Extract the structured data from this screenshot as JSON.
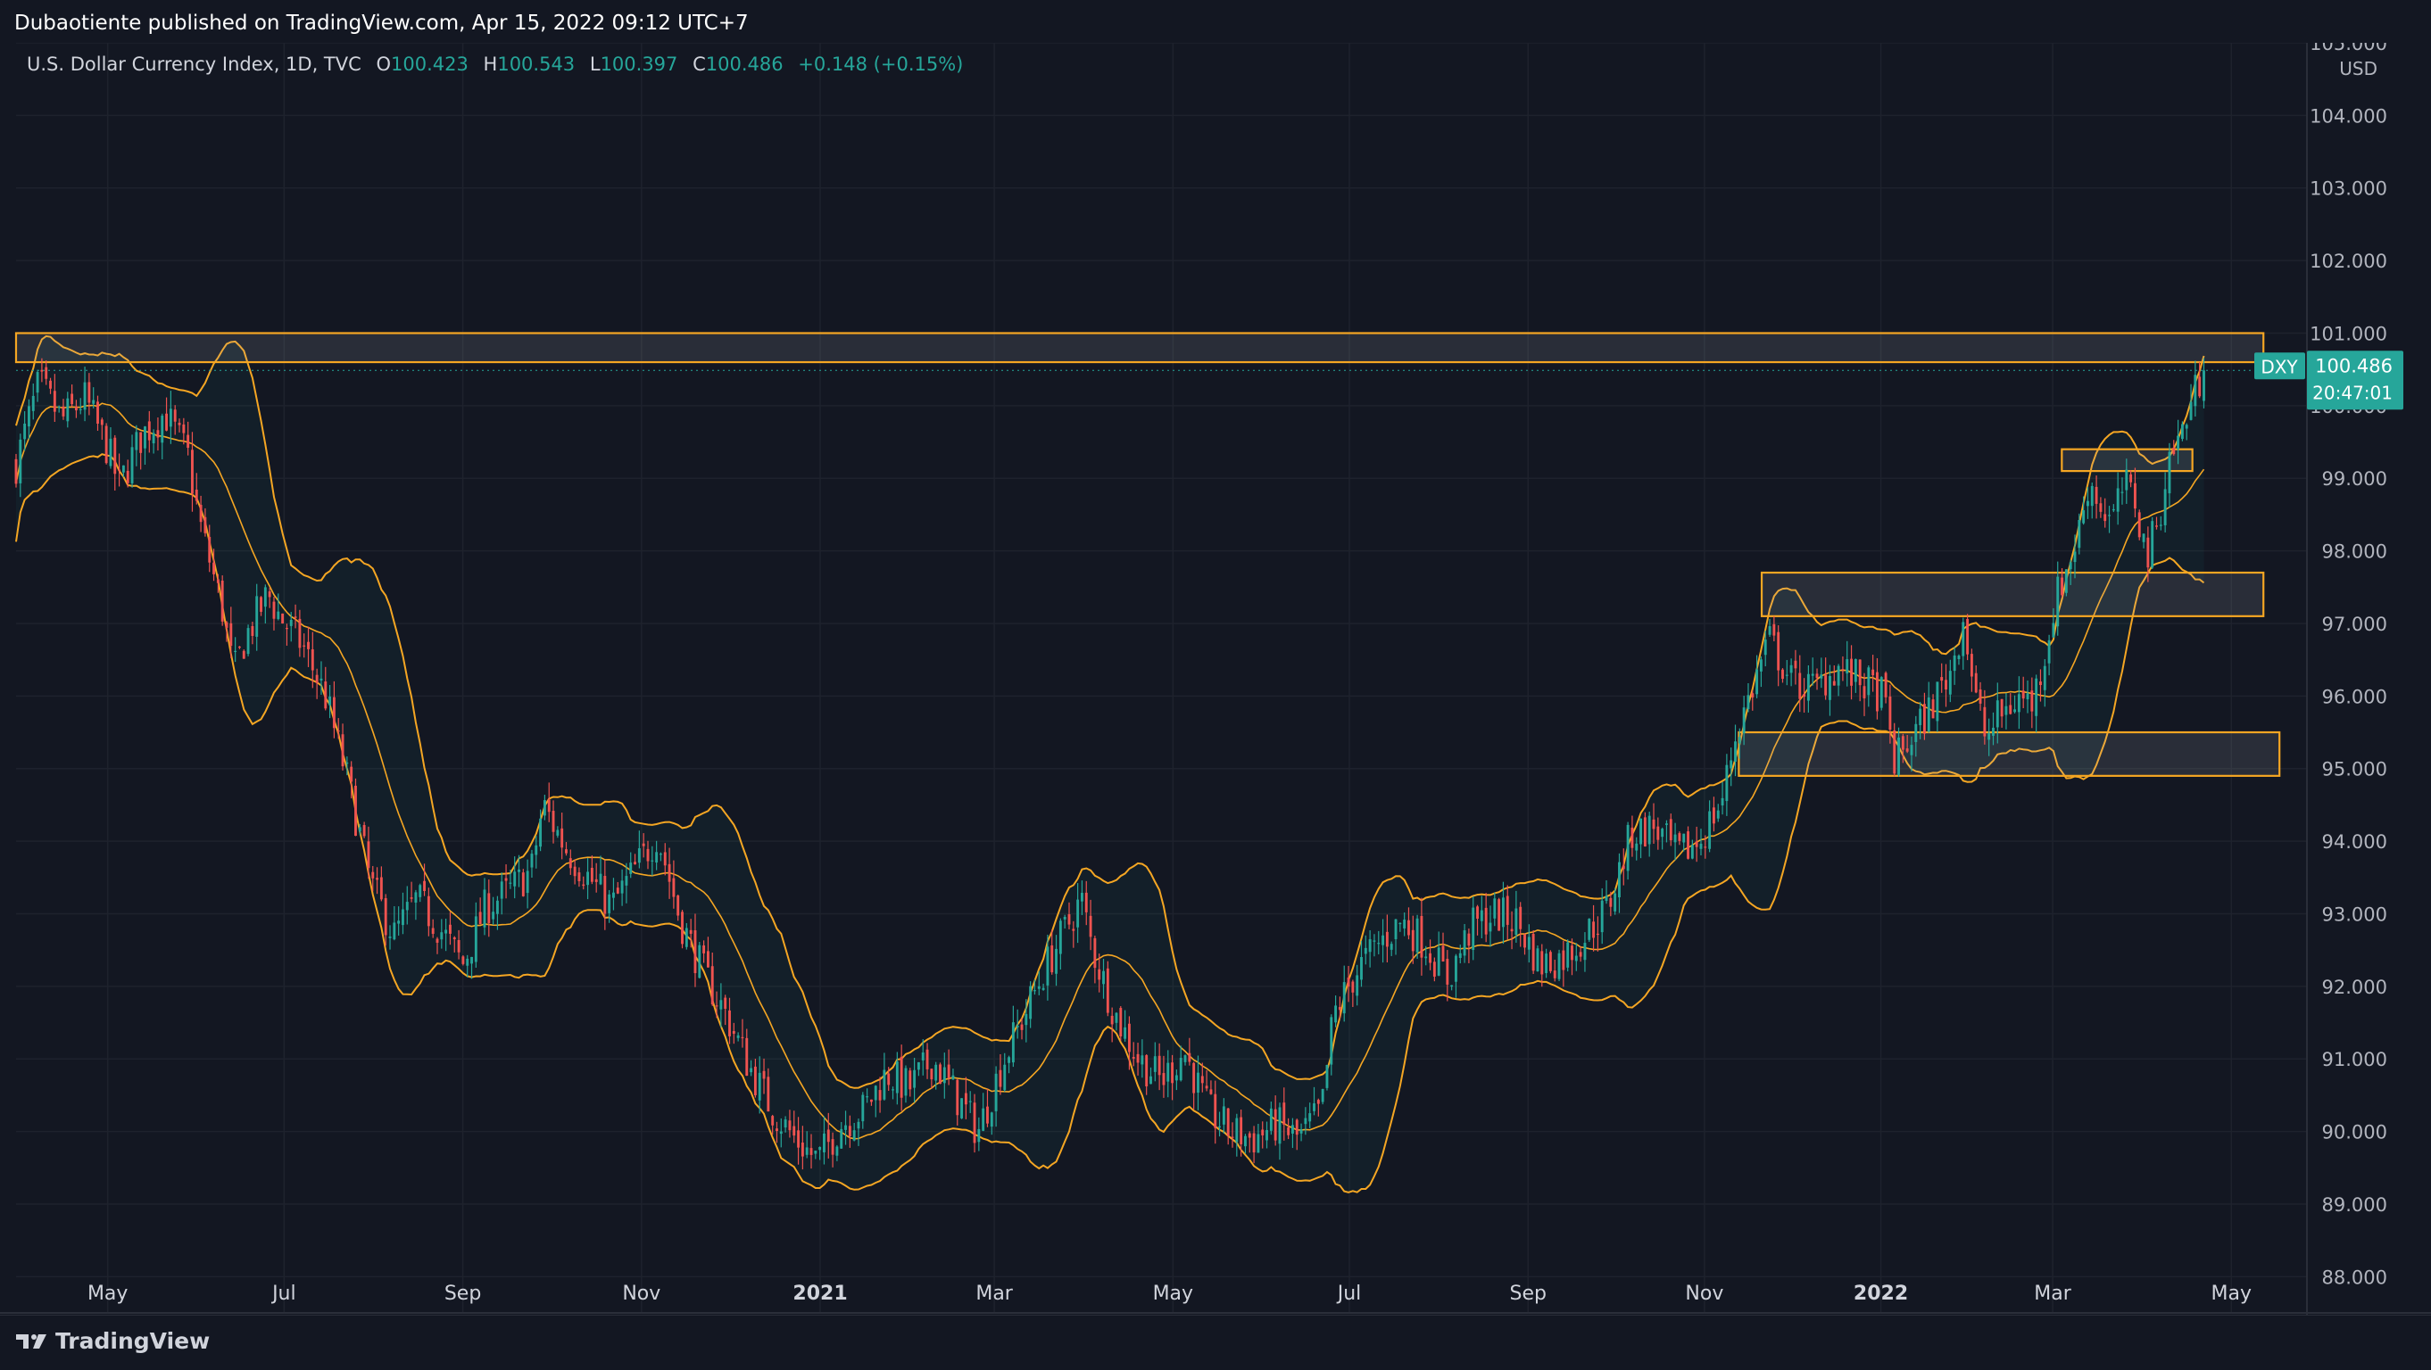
{
  "header": {
    "published": "Dubaotiente published on TradingView.com, Apr 15, 2022 09:12 UTC+7"
  },
  "legend": {
    "symbol": "U.S. Dollar Currency Index, 1D, TVC",
    "o_label": "O",
    "o": "100.423",
    "h_label": "H",
    "h": "100.543",
    "l_label": "L",
    "l": "100.397",
    "c_label": "C",
    "c": "100.486",
    "change": "+0.148 (+0.15%)"
  },
  "price_label": {
    "ticker": "DXY",
    "price": "100.486",
    "countdown": "20:47:01"
  },
  "footer": {
    "brand": "TradingView"
  },
  "colors": {
    "background": "#131722",
    "up": "#26a69a",
    "down": "#ef5350",
    "band": "#f5a623",
    "zone_border": "#f5a623"
  },
  "chart_data": {
    "type": "candlestick",
    "currency": "USD",
    "y_ticks": [
      "88.000",
      "89.000",
      "90.000",
      "91.000",
      "92.000",
      "93.000",
      "94.000",
      "95.000",
      "96.000",
      "97.000",
      "98.000",
      "99.000",
      "100.000",
      "101.000",
      "102.000",
      "103.000",
      "104.000",
      "105.000"
    ],
    "ylim": [
      87.5,
      105.0
    ],
    "x_ticks": [
      {
        "label": "May",
        "t": 0.04
      },
      {
        "label": "Jul",
        "t": 0.117
      },
      {
        "label": "Sep",
        "t": 0.195
      },
      {
        "label": "Nov",
        "t": 0.273
      },
      {
        "label": "2021",
        "t": 0.351,
        "bold": true
      },
      {
        "label": "Mar",
        "t": 0.427
      },
      {
        "label": "May",
        "t": 0.505
      },
      {
        "label": "Jul",
        "t": 0.582
      },
      {
        "label": "Sep",
        "t": 0.66
      },
      {
        "label": "Nov",
        "t": 0.737
      },
      {
        "label": "2022",
        "t": 0.814,
        "bold": true
      },
      {
        "label": "Mar",
        "t": 0.889
      },
      {
        "label": "May",
        "t": 0.967
      }
    ],
    "price_path": [
      [
        0.0,
        99.2
      ],
      [
        0.01,
        100.3
      ],
      [
        0.02,
        99.8
      ],
      [
        0.03,
        100.1
      ],
      [
        0.04,
        99.4
      ],
      [
        0.045,
        98.9
      ],
      [
        0.055,
        99.6
      ],
      [
        0.065,
        99.9
      ],
      [
        0.075,
        99.3
      ],
      [
        0.08,
        98.4
      ],
      [
        0.09,
        97.2
      ],
      [
        0.095,
        96.3
      ],
      [
        0.1,
        96.8
      ],
      [
        0.11,
        97.4
      ],
      [
        0.115,
        97.1
      ],
      [
        0.125,
        96.7
      ],
      [
        0.135,
        96.0
      ],
      [
        0.145,
        94.8
      ],
      [
        0.155,
        93.4
      ],
      [
        0.165,
        92.7
      ],
      [
        0.175,
        93.2
      ],
      [
        0.185,
        92.8
      ],
      [
        0.195,
        92.3
      ],
      [
        0.205,
        93.1
      ],
      [
        0.215,
        93.3
      ],
      [
        0.225,
        93.6
      ],
      [
        0.23,
        94.5
      ],
      [
        0.24,
        93.9
      ],
      [
        0.25,
        93.5
      ],
      [
        0.26,
        93.1
      ],
      [
        0.27,
        93.6
      ],
      [
        0.28,
        94.1
      ],
      [
        0.29,
        92.9
      ],
      [
        0.3,
        92.2
      ],
      [
        0.31,
        91.6
      ],
      [
        0.32,
        90.9
      ],
      [
        0.33,
        90.3
      ],
      [
        0.34,
        89.9
      ],
      [
        0.35,
        89.6
      ],
      [
        0.36,
        90.1
      ],
      [
        0.37,
        90.3
      ],
      [
        0.38,
        90.8
      ],
      [
        0.39,
        90.6
      ],
      [
        0.4,
        91.0
      ],
      [
        0.41,
        90.5
      ],
      [
        0.42,
        90.0
      ],
      [
        0.43,
        90.9
      ],
      [
        0.44,
        91.6
      ],
      [
        0.45,
        92.3
      ],
      [
        0.46,
        92.9
      ],
      [
        0.465,
        93.2
      ],
      [
        0.47,
        92.5
      ],
      [
        0.48,
        91.6
      ],
      [
        0.49,
        91.0
      ],
      [
        0.5,
        90.7
      ],
      [
        0.51,
        91.1
      ],
      [
        0.52,
        90.3
      ],
      [
        0.53,
        90.0
      ],
      [
        0.54,
        89.9
      ],
      [
        0.55,
        90.1
      ],
      [
        0.56,
        89.9
      ],
      [
        0.57,
        90.3
      ],
      [
        0.575,
        91.6
      ],
      [
        0.585,
        92.2
      ],
      [
        0.595,
        92.6
      ],
      [
        0.605,
        92.9
      ],
      [
        0.615,
        92.6
      ],
      [
        0.625,
        92.1
      ],
      [
        0.635,
        92.8
      ],
      [
        0.645,
        93.0
      ],
      [
        0.655,
        92.9
      ],
      [
        0.665,
        92.3
      ],
      [
        0.675,
        92.4
      ],
      [
        0.685,
        92.7
      ],
      [
        0.695,
        93.1
      ],
      [
        0.705,
        94.1
      ],
      [
        0.715,
        94.2
      ],
      [
        0.725,
        93.8
      ],
      [
        0.735,
        94.0
      ],
      [
        0.745,
        94.6
      ],
      [
        0.75,
        95.4
      ],
      [
        0.76,
        96.3
      ],
      [
        0.765,
        96.8
      ],
      [
        0.775,
        96.2
      ],
      [
        0.785,
        96.1
      ],
      [
        0.795,
        96.4
      ],
      [
        0.805,
        96.2
      ],
      [
        0.815,
        96.0
      ],
      [
        0.82,
        95.1
      ],
      [
        0.825,
        95.3
      ],
      [
        0.835,
        95.8
      ],
      [
        0.845,
        96.4
      ],
      [
        0.85,
        97.1
      ],
      [
        0.855,
        96.0
      ],
      [
        0.86,
        95.4
      ],
      [
        0.865,
        95.7
      ],
      [
        0.875,
        96.0
      ],
      [
        0.88,
        95.9
      ],
      [
        0.885,
        96.5
      ],
      [
        0.89,
        97.3
      ],
      [
        0.9,
        98.2
      ],
      [
        0.905,
        99.0
      ],
      [
        0.91,
        98.6
      ],
      [
        0.915,
        98.4
      ],
      [
        0.92,
        98.9
      ],
      [
        0.925,
        98.7
      ],
      [
        0.93,
        97.9
      ],
      [
        0.935,
        98.4
      ],
      [
        0.94,
        99.3
      ],
      [
        0.945,
        99.6
      ],
      [
        0.95,
        100.1
      ],
      [
        0.955,
        100.49
      ]
    ],
    "zones": [
      {
        "t0": 0.0,
        "t1": 0.981,
        "y_low": 100.6,
        "y_high": 101.0
      },
      {
        "t0": 0.893,
        "t1": 0.95,
        "y_low": 99.1,
        "y_high": 99.4
      },
      {
        "t0": 0.762,
        "t1": 0.981,
        "y_low": 97.1,
        "y_high": 97.7
      },
      {
        "t0": 0.752,
        "t1": 0.988,
        "y_low": 94.9,
        "y_high": 95.5
      }
    ],
    "last_price": 100.486,
    "bollinger": {
      "window": 20,
      "std": 2
    }
  }
}
